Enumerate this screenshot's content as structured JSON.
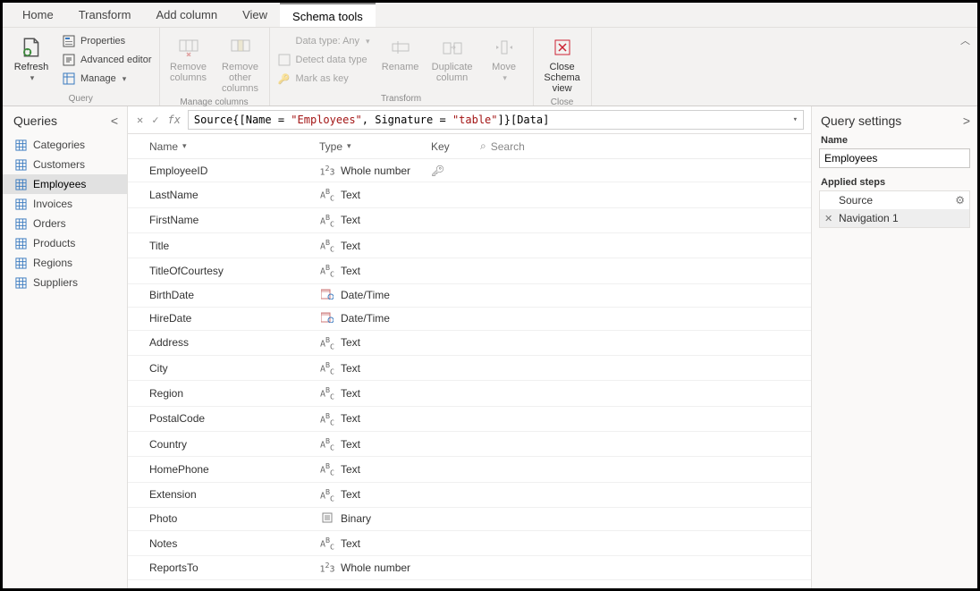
{
  "tabs": [
    "Home",
    "Transform",
    "Add column",
    "View",
    "Schema tools"
  ],
  "ribbon": {
    "query": {
      "label": "Query",
      "refresh": "Refresh",
      "properties": "Properties",
      "advanced": "Advanced editor",
      "manage": "Manage"
    },
    "manage_cols": {
      "label": "Manage columns",
      "remove": "Remove columns",
      "remove_other": "Remove other columns"
    },
    "transform": {
      "label": "Transform",
      "datatype": "Data type: Any",
      "detect": "Detect data type",
      "mark_key": "Mark as key",
      "rename": "Rename",
      "duplicate": "Duplicate column",
      "move": "Move"
    },
    "close": {
      "label": "Close",
      "close_view": "Close Schema view"
    }
  },
  "sidebar": {
    "title": "Queries",
    "items": [
      "Categories",
      "Customers",
      "Employees",
      "Invoices",
      "Orders",
      "Products",
      "Regions",
      "Suppliers"
    ],
    "selected": 2
  },
  "formula": {
    "pre": "Source{[Name = ",
    "str1": "\"Employees\"",
    "mid": ", Signature = ",
    "str2": "\"table\"",
    "post": "]}[Data]"
  },
  "schema": {
    "name_h": "Name",
    "type_h": "Type",
    "key_h": "Key",
    "search": "Search",
    "rows": [
      {
        "name": "EmployeeID",
        "type": "Whole number",
        "icon": "num",
        "key": true
      },
      {
        "name": "LastName",
        "type": "Text",
        "icon": "txt"
      },
      {
        "name": "FirstName",
        "type": "Text",
        "icon": "txt"
      },
      {
        "name": "Title",
        "type": "Text",
        "icon": "txt"
      },
      {
        "name": "TitleOfCourtesy",
        "type": "Text",
        "icon": "txt"
      },
      {
        "name": "BirthDate",
        "type": "Date/Time",
        "icon": "dt"
      },
      {
        "name": "HireDate",
        "type": "Date/Time",
        "icon": "dt"
      },
      {
        "name": "Address",
        "type": "Text",
        "icon": "txt"
      },
      {
        "name": "City",
        "type": "Text",
        "icon": "txt"
      },
      {
        "name": "Region",
        "type": "Text",
        "icon": "txt"
      },
      {
        "name": "PostalCode",
        "type": "Text",
        "icon": "txt"
      },
      {
        "name": "Country",
        "type": "Text",
        "icon": "txt"
      },
      {
        "name": "HomePhone",
        "type": "Text",
        "icon": "txt"
      },
      {
        "name": "Extension",
        "type": "Text",
        "icon": "txt"
      },
      {
        "name": "Photo",
        "type": "Binary",
        "icon": "bin"
      },
      {
        "name": "Notes",
        "type": "Text",
        "icon": "txt"
      },
      {
        "name": "ReportsTo",
        "type": "Whole number",
        "icon": "num"
      }
    ]
  },
  "settings": {
    "title": "Query settings",
    "name_label": "Name",
    "name_value": "Employees",
    "applied_label": "Applied steps",
    "steps": [
      {
        "label": "Source",
        "gear": true
      },
      {
        "label": "Navigation 1",
        "del": true,
        "selected": true
      }
    ]
  }
}
